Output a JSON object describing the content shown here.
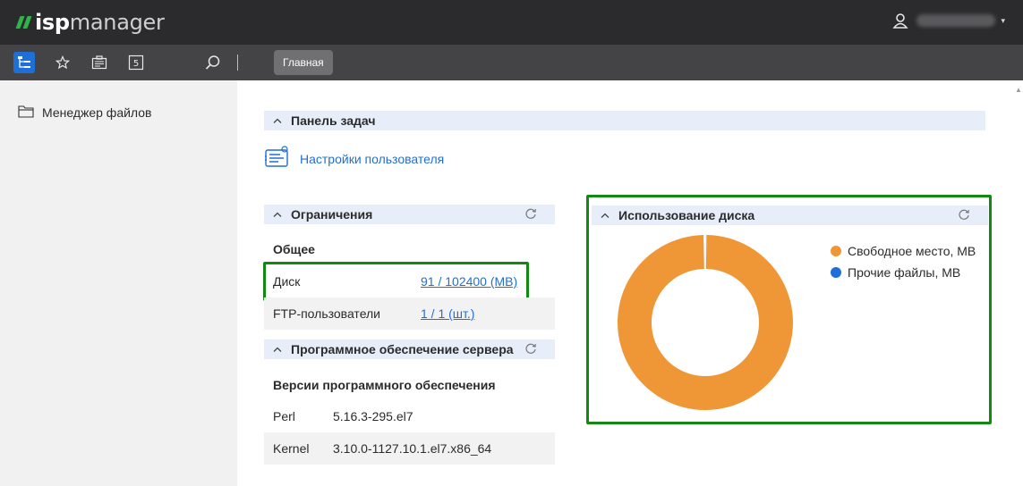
{
  "app": {
    "logo_a": "isp",
    "logo_b": "manager"
  },
  "toolbar": {
    "home_tab": "Главная"
  },
  "sidebar": {
    "items": [
      {
        "label": "Менеджер файлов",
        "icon": "folder-icon"
      }
    ]
  },
  "task_panel": {
    "title": "Панель задач",
    "user_settings": "Настройки пользователя"
  },
  "limits": {
    "title": "Ограничения",
    "general": "Общее",
    "rows": [
      {
        "label": "Диск",
        "value": "91 / 102400 (MB)"
      },
      {
        "label": "FTP-пользователи",
        "value": "1 / 1 (шт.)"
      }
    ]
  },
  "software": {
    "title": "Программное обеспечение сервера",
    "versions_title": "Версии программного обеспечения",
    "rows": [
      {
        "label": "Perl",
        "value": "5.16.3-295.el7"
      },
      {
        "label": "Kernel",
        "value": "3.10.0-1127.10.1.el7.x86_64"
      }
    ]
  },
  "disk_usage": {
    "title": "Использование диска"
  },
  "chart_data": {
    "type": "pie",
    "categories": [
      "Свободное место, MB",
      "Прочие файлы, MB"
    ],
    "values": [
      102309,
      91
    ],
    "colors": [
      "#ef9637",
      "#1e6fd6"
    ],
    "legend": "right"
  },
  "colors": {
    "accent": "#1e6fd6",
    "highlight": "#118a11",
    "topbar": "#2b2b2d",
    "toolbar": "#444446"
  }
}
